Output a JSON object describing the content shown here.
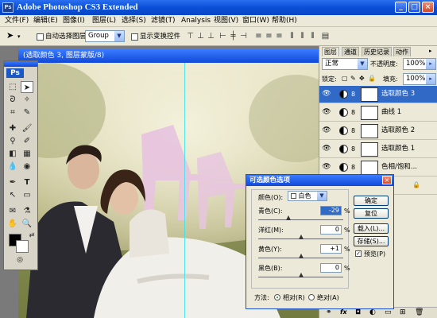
{
  "app": {
    "title": "Adobe Photoshop CS3 Extended",
    "ps_label": "Ps",
    "window_buttons": {
      "minimize": "_",
      "maximize": "□",
      "close": "×"
    }
  },
  "menu": [
    "文件(F)",
    "编辑(E)",
    "图像(I)",
    "图层(L)",
    "选择(S)",
    "滤镜(T)",
    "Analysis",
    "视图(V)",
    "窗口(W)",
    "帮助(H)"
  ],
  "options": {
    "auto_select_label": "自动选择图层",
    "auto_select_value": "Group",
    "show_transform_label": "显示变换控件"
  },
  "document": {
    "title": "(选取颜色 3, 图层蒙版/8)"
  },
  "layers_panel": {
    "tabs": [
      "图层",
      "通道",
      "历史记录",
      "动作"
    ],
    "blend_mode": "正常",
    "opacity_label": "不透明度:",
    "opacity_value": "100%",
    "lock_label": "锁定:",
    "fill_label": "填充:",
    "fill_value": "100%",
    "layers": [
      {
        "name": "选取颜色 3",
        "selected": true
      },
      {
        "name": "曲线 1",
        "selected": false
      },
      {
        "name": "选取颜色 2",
        "selected": false
      },
      {
        "name": "选取颜色 1",
        "selected": false
      },
      {
        "name": "色相/饱和...",
        "selected": false
      },
      {
        "name": "背景",
        "selected": false
      }
    ],
    "bottom_icons": [
      "link-icon",
      "fx-icon",
      "mask-icon",
      "adjustment-icon",
      "folder-icon",
      "new-layer-icon",
      "trash-icon"
    ]
  },
  "dialog": {
    "title": "可选颜色选项",
    "color_label": "颜色(O):",
    "color_value": "白色",
    "sliders": [
      {
        "label": "青色(C):",
        "value": "-29",
        "unit": "%",
        "level": -29
      },
      {
        "label": "洋红(M):",
        "value": "0",
        "unit": "%",
        "level": 0
      },
      {
        "label": "黄色(Y):",
        "value": "+1",
        "unit": "%",
        "level": 1
      },
      {
        "label": "黑色(B):",
        "value": "0",
        "unit": "%",
        "level": 0
      }
    ],
    "buttons": {
      "ok": "确定",
      "reset": "复位",
      "load": "载入(L)...",
      "save": "存储(S)..."
    },
    "preview_label": "预览(P)",
    "method_label": "方法:",
    "relative_label": "相对(R)",
    "absolute_label": "绝对(A)"
  }
}
